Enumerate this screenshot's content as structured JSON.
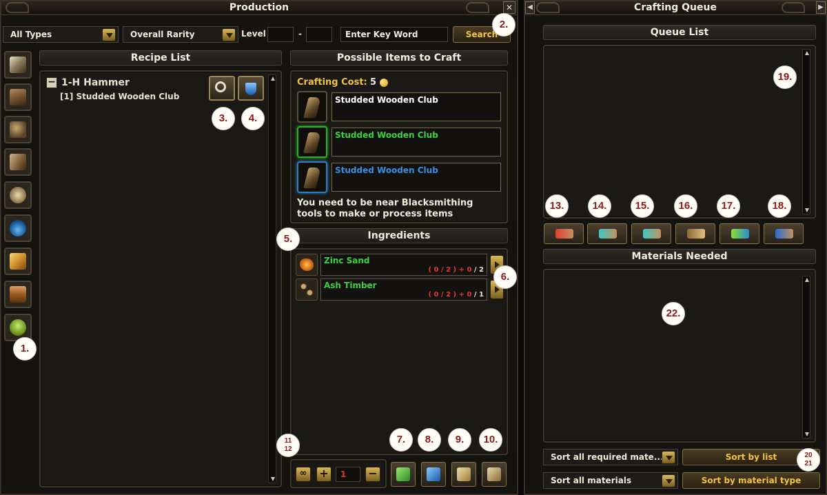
{
  "production": {
    "title": "Production",
    "close_label": "✕",
    "filters": {
      "type_dropdown": "All Types",
      "rarity_dropdown": "Overall Rarity",
      "level_label": "Level",
      "level_min": "",
      "level_dash": "-",
      "level_max": "",
      "keyword_placeholder": "Enter Key Word",
      "search_button": "Search"
    },
    "recipe_list": {
      "header": "Recipe List",
      "group_toggle": "−",
      "group_name": "1-H Hammer",
      "recipes": [
        "[1] Studded Wooden Club"
      ]
    },
    "possible_items": {
      "header": "Possible Items to Craft",
      "crafting_cost_label": "Crafting Cost:",
      "crafting_cost_value": "5",
      "items": [
        {
          "name": "Studded Wooden Club",
          "color": "#ffffff",
          "border": "#5a5040"
        },
        {
          "name": "Studded Wooden Club",
          "color": "#3bd33b",
          "border": "#28b428"
        },
        {
          "name": "Studded Wooden Club",
          "color": "#3a8fe0",
          "border": "#2f7fbf"
        }
      ],
      "notice": "You need to be near Blacksmithing tools to make or process items"
    },
    "ingredients": {
      "header": "Ingredients",
      "items": [
        {
          "name": "Zinc Sand",
          "have": "( 0 / 2 )",
          "plus": "+ 0",
          "need": "/ 2"
        },
        {
          "name": "Ash Timber",
          "have": "( 0 / 2 )",
          "plus": "+ 0",
          "need": "/ 1"
        }
      ]
    },
    "quantity": {
      "infinite_label": "∞",
      "plus_label": "+",
      "value": "1",
      "minus_label": "−"
    }
  },
  "queue": {
    "title": "Crafting Queue",
    "queue_list_header": "Queue List",
    "materials_header": "Materials Needed",
    "sort_required_dropdown": "Sort all required mate...",
    "sort_all_dropdown": "Sort all materials",
    "sort_by_list_button": "Sort by list",
    "sort_by_type_button": "Sort by material type"
  },
  "callouts": {
    "c1": "1.",
    "c2": "2.",
    "c3": "3.",
    "c4": "4.",
    "c5": "5.",
    "c6": "6.",
    "c7": "7.",
    "c8": "8.",
    "c9": "9.",
    "c10": "10.",
    "c11": "11",
    "c12": "12",
    "c13": "13.",
    "c14": "14.",
    "c15": "15.",
    "c16": "16.",
    "c17": "17.",
    "c18": "18.",
    "c19": "19.",
    "c20": "20",
    "c21": "21",
    "c22": "22."
  },
  "icons": {
    "categories": [
      "blade-icon",
      "timber-icon",
      "armor-icon",
      "leather-icon",
      "food-icon",
      "potion-icon",
      "ingot-icon",
      "plank-icon",
      "herb-icon"
    ],
    "ingredients": [
      "zinc-sand-icon",
      "ash-timber-icon"
    ]
  },
  "colors": {
    "gold_text": "#f3c33d",
    "green_item": "#3bd33b",
    "blue_item": "#3a8fe0",
    "red_count": "#e23a2c",
    "callout_text": "#8b1a1a"
  }
}
